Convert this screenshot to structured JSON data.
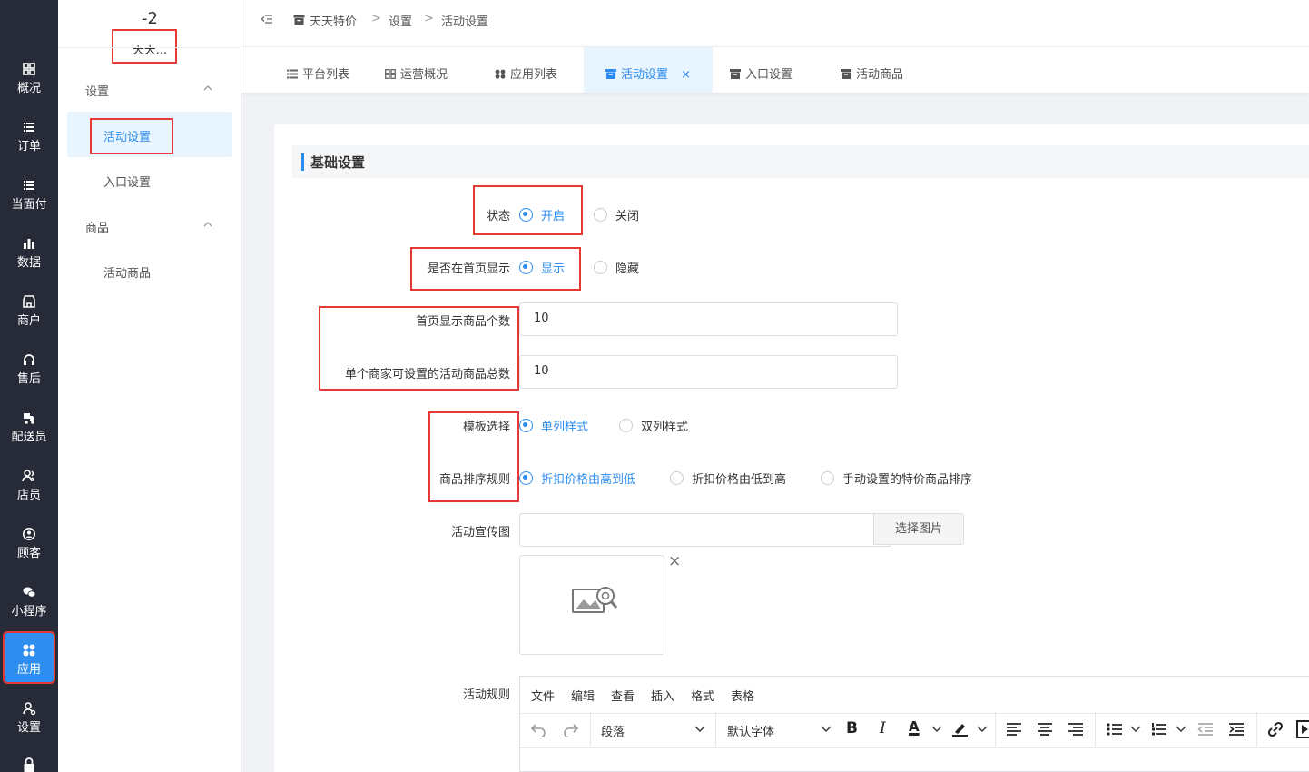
{
  "rail": {
    "items": [
      {
        "label": "概况",
        "icon": "overview-icon"
      },
      {
        "label": "订单",
        "icon": "list-icon"
      },
      {
        "label": "当面付",
        "icon": "list-icon"
      },
      {
        "label": "数据",
        "icon": "bar-chart-icon"
      },
      {
        "label": "商户",
        "icon": "shop-icon"
      },
      {
        "label": "售后",
        "icon": "headset-icon"
      },
      {
        "label": "配送员",
        "icon": "delivery-icon"
      },
      {
        "label": "店员",
        "icon": "staff-icon"
      },
      {
        "label": "顾客",
        "icon": "customer-icon"
      },
      {
        "label": "小程序",
        "icon": "wechat-icon"
      },
      {
        "label": "应用",
        "icon": "apps-icon"
      },
      {
        "label": "设置",
        "icon": "user-settings-icon"
      }
    ],
    "active_index": 10
  },
  "sidebar": {
    "counter": "-2",
    "store_name": "天天...",
    "groups": [
      {
        "title": "设置",
        "items": [
          "活动设置",
          "入口设置"
        ]
      },
      {
        "title": "商品",
        "items": [
          "活动商品"
        ]
      }
    ]
  },
  "breadcrumb": [
    "天天特价",
    "设置",
    "活动设置"
  ],
  "breadcrumb_sep": ">",
  "tabs": [
    {
      "label": "平台列表",
      "icon": "list-icon"
    },
    {
      "label": "运营概况",
      "icon": "grid-icon"
    },
    {
      "label": "应用列表",
      "icon": "apps-icon"
    },
    {
      "label": "活动设置",
      "icon": "archive-icon",
      "active": true,
      "close": "×"
    },
    {
      "label": "入口设置",
      "icon": "archive-icon"
    },
    {
      "label": "活动商品",
      "icon": "archive-icon"
    }
  ],
  "form": {
    "section_title": "基础设置",
    "status": {
      "label": "状态",
      "options": [
        "开启",
        "关闭"
      ],
      "selected": "开启"
    },
    "home_display": {
      "label": "是否在首页显示",
      "options": [
        "显示",
        "隐藏"
      ],
      "selected": "显示"
    },
    "home_count": {
      "label": "首页显示商品个数",
      "value": "10"
    },
    "merchant_total": {
      "label": "单个商家可设置的活动商品总数",
      "value": "10"
    },
    "template": {
      "label": "模板选择",
      "options": [
        "单列样式",
        "双列样式"
      ],
      "selected": "单列样式"
    },
    "sort_rule": {
      "label": "商品排序规则",
      "options": [
        "折扣价格由高到低",
        "折扣价格由低到高",
        "手动设置的特价商品排序"
      ],
      "selected": "折扣价格由高到低"
    },
    "banner": {
      "label": "活动宣传图",
      "value": "",
      "button": "选择图片",
      "remove": "×"
    },
    "rules": {
      "label": "活动规则"
    }
  },
  "editor": {
    "menu": [
      "文件",
      "编辑",
      "查看",
      "插入",
      "格式",
      "表格"
    ],
    "paragraph": "段落",
    "font": "默认字体",
    "bold": "B",
    "italic": "I",
    "font_color": "A"
  },
  "colors": {
    "accent": "#2d8cf0",
    "rail_bg": "#262b37",
    "highlight": "#e53935"
  }
}
